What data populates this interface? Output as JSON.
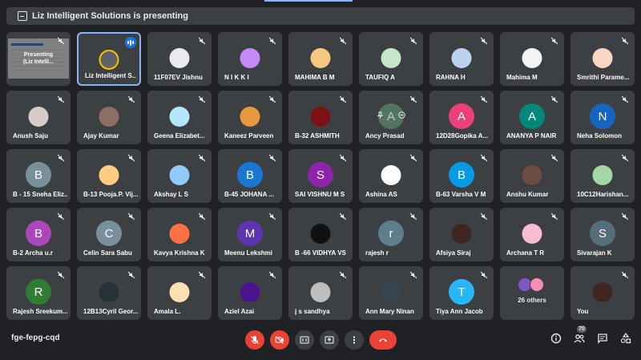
{
  "banner": {
    "text": "Liz Intelligent Solutions is presenting"
  },
  "presentation_tile": {
    "line1": "Presenting",
    "line2": "(Liz Intelli..."
  },
  "participants": [
    {
      "name": "Liz Intelligent S...",
      "initial": "",
      "color": "#5f6368",
      "speaking": true
    },
    {
      "name": "11F07EV Jishnu",
      "initial": "",
      "color": "#e8eaed"
    },
    {
      "name": "N I K K I",
      "initial": "",
      "color": "#c58af9"
    },
    {
      "name": "MAHIMA B M",
      "initial": "",
      "color": "#f6c97f"
    },
    {
      "name": "TAUFIQ A",
      "initial": "",
      "color": "#c8e6c9"
    },
    {
      "name": "RAHNA H",
      "initial": "",
      "color": "#bcd3f0"
    },
    {
      "name": "Mahima M",
      "initial": "",
      "color": "#f1f3f4"
    },
    {
      "name": "Smrithi Parame...",
      "initial": "",
      "color": "#f7d7c4"
    },
    {
      "name": "Anush Saju",
      "initial": "",
      "color": "#d7ccc8"
    },
    {
      "name": "Ajay Kumar",
      "initial": "",
      "color": "#8d6e63"
    },
    {
      "name": "Geena Elizabet...",
      "initial": "",
      "color": "#b3e5fc"
    },
    {
      "name": "Kaneez Parveen",
      "initial": "",
      "color": "#e69a3d"
    },
    {
      "name": "B-32 ASHMITH",
      "initial": "",
      "color": "#7b1113"
    },
    {
      "name": "Ancy Prasad",
      "initial": "A",
      "color": "#5e8a6a",
      "hover": true
    },
    {
      "name": "12D28Gopika A...",
      "initial": "A",
      "color": "#ec407a"
    },
    {
      "name": "ANANYA P NAIR",
      "initial": "A",
      "color": "#00897b"
    },
    {
      "name": "Neha Solomon",
      "initial": "N",
      "color": "#1565c0"
    },
    {
      "name": "B - 15 Sneha Eliz...",
      "initial": "B",
      "color": "#78909c"
    },
    {
      "name": "B-13 Pooja.P. Vij...",
      "initial": "",
      "color": "#ffcc80"
    },
    {
      "name": "Akshay L S",
      "initial": "",
      "color": "#90caf9"
    },
    {
      "name": "B-45 JOHANA ...",
      "initial": "B",
      "color": "#1976d2"
    },
    {
      "name": "SAI VISHNU M S",
      "initial": "S",
      "color": "#8e24aa"
    },
    {
      "name": "Ashina AS",
      "initial": "",
      "color": "#ffffff"
    },
    {
      "name": "B-63 Varsha V M",
      "initial": "B",
      "color": "#039be5"
    },
    {
      "name": "Anshu Kumar",
      "initial": "",
      "color": "#6d4c41"
    },
    {
      "name": "10C12Harishan...",
      "initial": "",
      "color": "#a5d6a7"
    },
    {
      "name": "B-2 Archa u.r",
      "initial": "B",
      "color": "#ab47bc"
    },
    {
      "name": "Celin Sara Sabu",
      "initial": "C",
      "color": "#78909c"
    },
    {
      "name": "Kavya Krishna K",
      "initial": "",
      "color": "#ff7043"
    },
    {
      "name": "Meenu Lekshmi",
      "initial": "M",
      "color": "#5e35b1"
    },
    {
      "name": "B -66 VIDHYA VS",
      "initial": "",
      "color": "#111111"
    },
    {
      "name": "rajesh r",
      "initial": "r",
      "color": "#607d8b"
    },
    {
      "name": "Afsiya Siraj",
      "initial": "",
      "color": "#3e2723"
    },
    {
      "name": "Archana T R",
      "initial": "",
      "color": "#f8bbd0"
    },
    {
      "name": "Sivarajan K",
      "initial": "S",
      "color": "#546e7a"
    },
    {
      "name": "Rajesh Sreekum...",
      "initial": "R",
      "color": "#2e7d32"
    },
    {
      "name": "12B13Cyril Geor...",
      "initial": "",
      "color": "#263238"
    },
    {
      "name": "Amala L.",
      "initial": "",
      "color": "#ffe0b2"
    },
    {
      "name": "Aziel Azai",
      "initial": "",
      "color": "#4a148c"
    },
    {
      "name": "j s sandhya",
      "initial": "",
      "color": "#bdbdbd"
    },
    {
      "name": "Ann Mary Ninan",
      "initial": "",
      "color": "#37474f"
    },
    {
      "name": "Tiya Ann Jacob",
      "initial": "T",
      "color": "#29b6f6"
    }
  ],
  "others_tile": {
    "label": "26 others"
  },
  "self_tile": {
    "name": "You",
    "color": "#3e2723"
  },
  "meeting_code": "fge-fepg-cqd",
  "people_count": "70",
  "colors": {
    "background": "#202124",
    "tile": "#3c4043",
    "danger": "#ea4335",
    "accent": "#8ab4f8"
  }
}
